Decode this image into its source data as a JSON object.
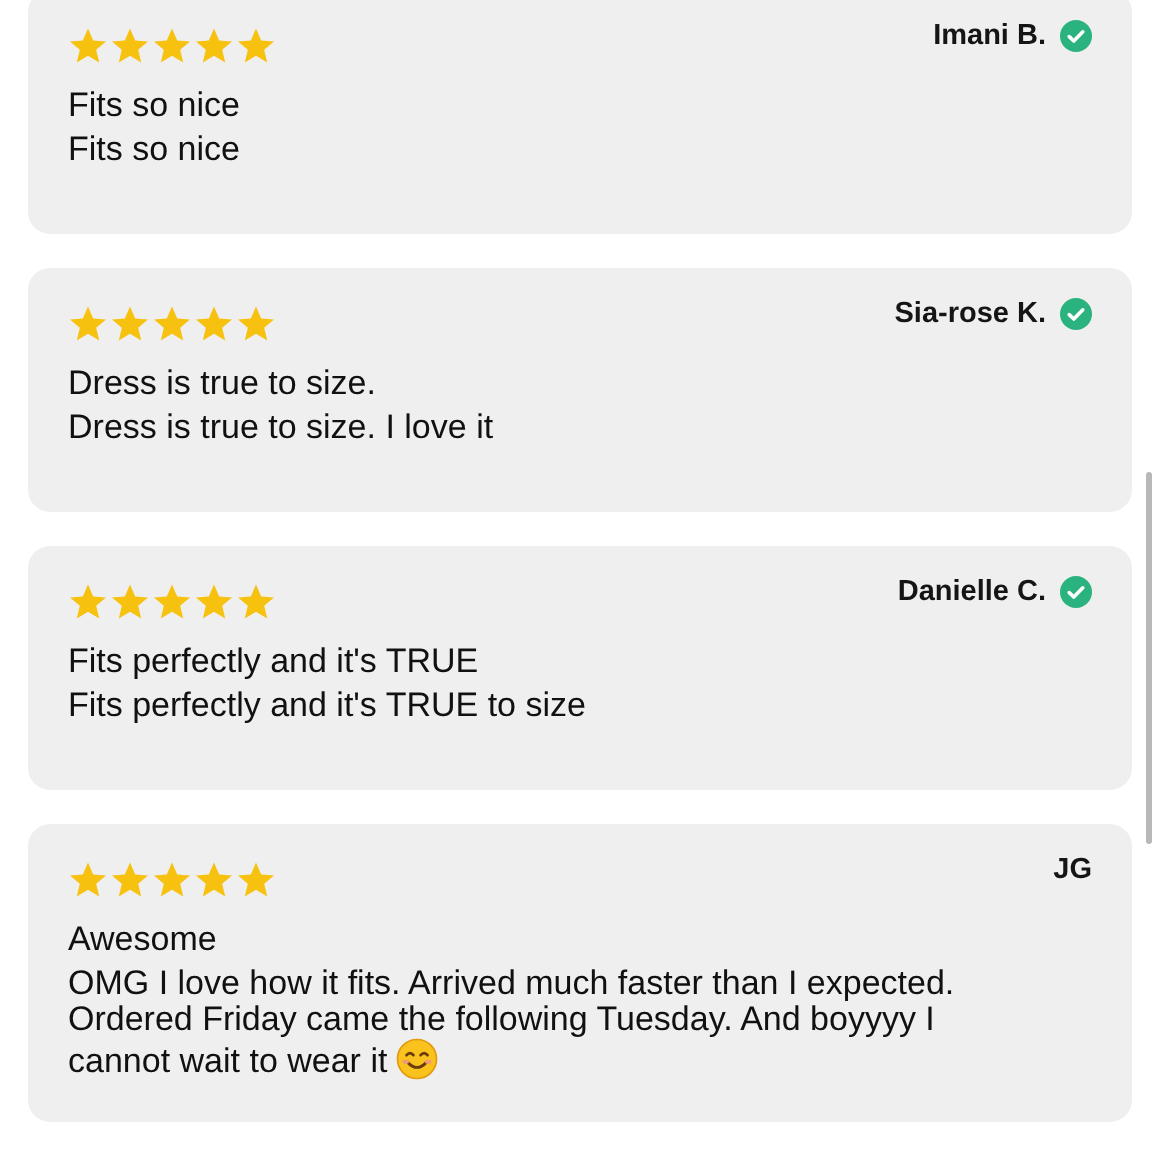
{
  "reviews": [
    {
      "stars": 5,
      "author": "Imani B.",
      "verified": true,
      "title": "Fits so nice",
      "body": "Fits so nice",
      "emoji": false
    },
    {
      "stars": 5,
      "author": "Sia-rose K.",
      "verified": true,
      "title": "Dress is true to size.",
      "body": "Dress is true to size. I love it",
      "emoji": false
    },
    {
      "stars": 5,
      "author": "Danielle C.",
      "verified": true,
      "title": "Fits perfectly and it's TRUE",
      "body": "Fits perfectly and it's TRUE to size",
      "emoji": false
    },
    {
      "stars": 5,
      "author": "JG",
      "verified": false,
      "title": "Awesome",
      "body": "OMG I love how it fits. Arrived much faster than I expected. Ordered Friday came the following Tuesday. And boyyyy I cannot wait to wear it",
      "emoji": true
    }
  ]
}
